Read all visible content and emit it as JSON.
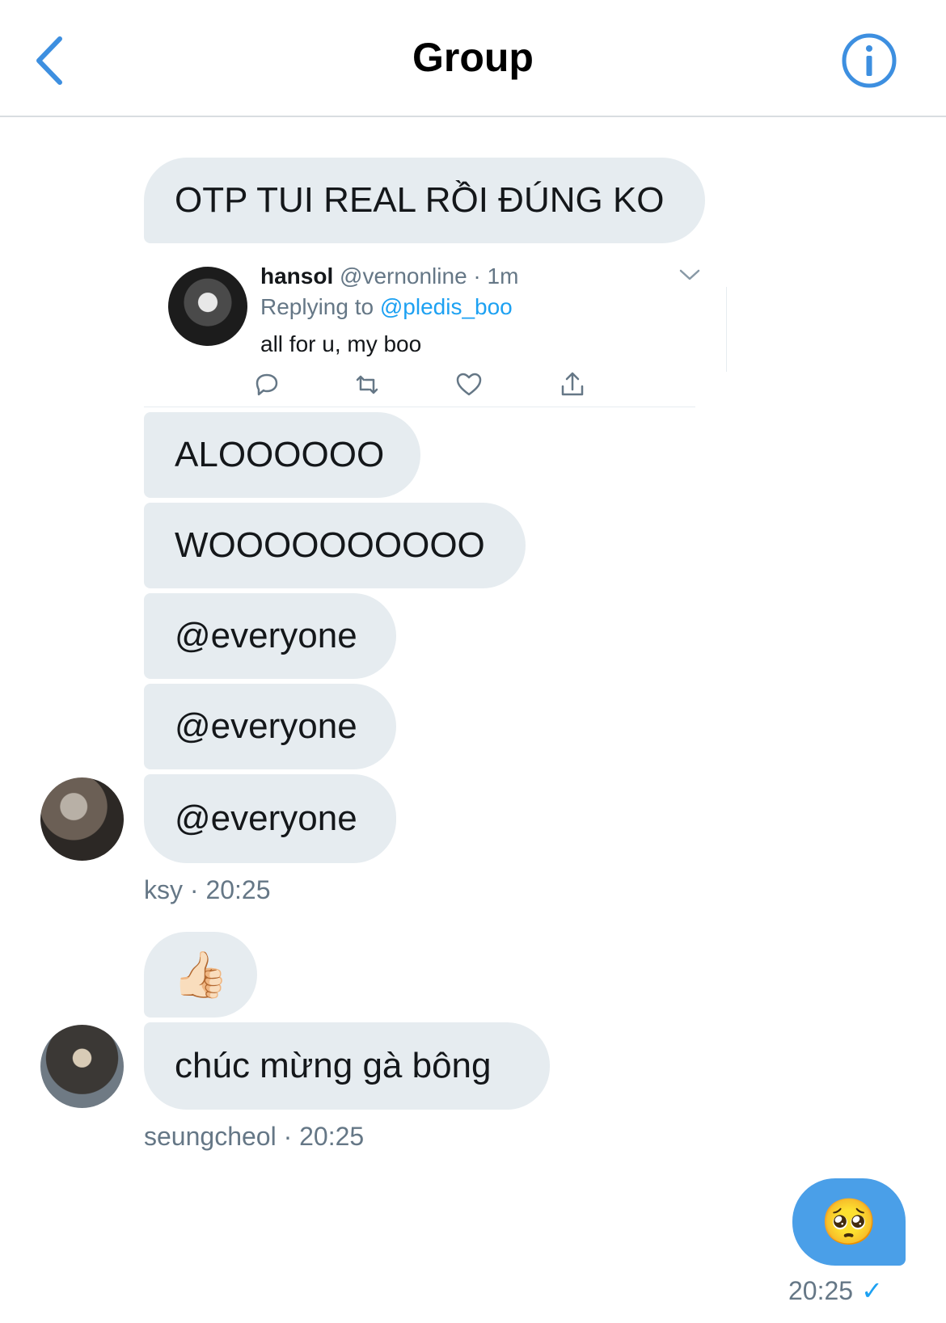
{
  "header": {
    "title": "Group",
    "back_icon": "chevron-left-icon",
    "info_icon": "info-circle-icon",
    "accent": "#3d8fe0"
  },
  "messages": {
    "otp": "OTP TUI REAL RỒI ĐÚNG KO",
    "tweet": {
      "name": "hansol",
      "handle": "@vernonline",
      "time": "· 1m",
      "reply_prefix": "Replying to",
      "reply_handle": "@pledis_boo",
      "text": "all for u, my boo",
      "actions": [
        "reply-icon",
        "retweet-icon",
        "like-icon",
        "share-icon"
      ]
    },
    "alo": "ALOOOOOO",
    "woo": "WOOOOOOOOOO",
    "everyone_1": "@everyone",
    "everyone_2": "@everyone",
    "everyone_3": "@everyone",
    "thumb": "👍🏻",
    "chuc": "chúc mừng gà bông",
    "mine": "🥺"
  },
  "meta": {
    "ksy": "ksy · 20:25",
    "seungcheol": "seungcheol  · 20:25",
    "mine_time": "20:25",
    "mine_status": "✓"
  },
  "colors": {
    "bubble": "#e6ecf0",
    "my_bubble": "#4a9fe8",
    "muted": "#657786",
    "link": "#1da1f2"
  }
}
